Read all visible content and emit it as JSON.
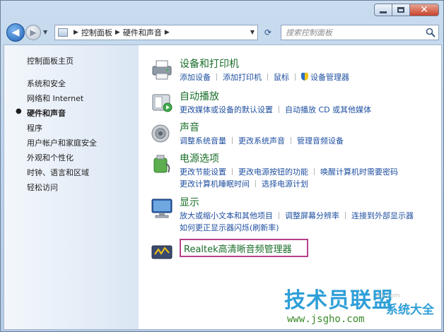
{
  "window": {
    "close_glyph": "✕"
  },
  "nav": {
    "breadcrumbs": [
      "控制面板",
      "硬件和声音"
    ],
    "search_placeholder": "搜索控制面板"
  },
  "sidebar": {
    "home": "控制面板主页",
    "items": [
      {
        "label": "系统和安全",
        "active": false
      },
      {
        "label": "网络和 Internet",
        "active": false
      },
      {
        "label": "硬件和声音",
        "active": true
      },
      {
        "label": "程序",
        "active": false
      },
      {
        "label": "用户帐户和家庭安全",
        "active": false
      },
      {
        "label": "外观和个性化",
        "active": false
      },
      {
        "label": "时钟、语言和区域",
        "active": false
      },
      {
        "label": "轻松访问",
        "active": false
      }
    ]
  },
  "categories": [
    {
      "title": "设备和打印机",
      "icon": "printer-icon",
      "links": [
        [
          "添加设备",
          "添加打印机",
          "鼠标",
          "设备管理器"
        ]
      ]
    },
    {
      "title": "自动播放",
      "icon": "autoplay-icon",
      "links": [
        [
          "更改媒体或设备的默认设置",
          "自动播放 CD 或其他媒体"
        ]
      ]
    },
    {
      "title": "声音",
      "icon": "speaker-icon",
      "links": [
        [
          "调整系统音量",
          "更改系统声音",
          "管理音频设备"
        ]
      ]
    },
    {
      "title": "电源选项",
      "icon": "power-icon",
      "links": [
        [
          "更改节能设置",
          "更改电源按钮的功能",
          "唤醒计算机时需要密码"
        ],
        [
          "更改计算机睡眠时间",
          "选择电源计划"
        ]
      ]
    },
    {
      "title": "显示",
      "icon": "display-icon",
      "links": [
        [
          "放大或缩小文本和其他项目",
          "调整屏幕分辨率",
          "连接到外部显示器"
        ],
        [
          "如何更正显示器闪烁(刷新率)"
        ]
      ]
    }
  ],
  "realtek": {
    "label": "Realtek高清晰音频管理器"
  },
  "watermark": {
    "big": "技术员联盟",
    "small": "系统大全",
    "url": "www.jsgho.com",
    "ghost": "85.com"
  }
}
